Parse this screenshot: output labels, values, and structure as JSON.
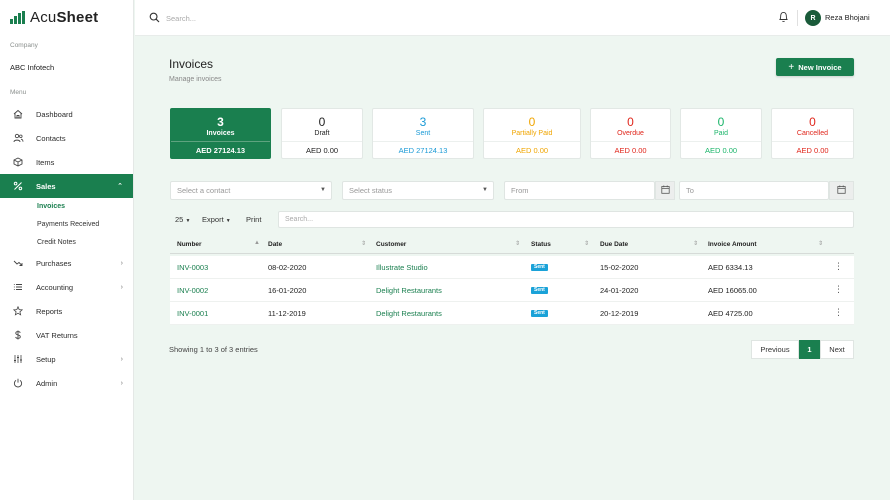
{
  "app": {
    "logo_text_light": "Acu",
    "logo_text_bold": "Sheet"
  },
  "sidebar": {
    "company_label": "Company",
    "company_name": "ABC Infotech",
    "menu_label": "Menu",
    "items": [
      {
        "label": "Dashboard",
        "icon": "home-icon"
      },
      {
        "label": "Contacts",
        "icon": "users-icon"
      },
      {
        "label": "Items",
        "icon": "box-icon"
      },
      {
        "label": "Sales",
        "icon": "percent-icon",
        "active": true
      },
      {
        "label": "Purchases",
        "icon": "trend-down-icon"
      },
      {
        "label": "Accounting",
        "icon": "list-icon"
      },
      {
        "label": "Reports",
        "icon": "star-icon"
      },
      {
        "label": "VAT Returns",
        "icon": "dollar-icon"
      },
      {
        "label": "Setup",
        "icon": "sliders-icon"
      },
      {
        "label": "Admin",
        "icon": "power-icon"
      }
    ],
    "sales_sub": [
      "Invoices",
      "Payments Received",
      "Credit Notes"
    ]
  },
  "topbar": {
    "search_placeholder": "Search...",
    "user_initial": "R",
    "user_name": "Reza Bhojani"
  },
  "page": {
    "title": "Invoices",
    "subtitle": "Manage invoices",
    "new_button": "New Invoice"
  },
  "status_cards": [
    {
      "count": "3",
      "label": "Invoices",
      "amount": "AED 27124.13",
      "color": "#ffffff"
    },
    {
      "count": "0",
      "label": "Draft",
      "amount": "AED 0.00",
      "color": "#222222"
    },
    {
      "count": "3",
      "label": "Sent",
      "amount": "AED 27124.13",
      "color": "#1a9ad6"
    },
    {
      "count": "0",
      "label": "Partially Paid",
      "amount": "AED 0.00",
      "color": "#f0a500"
    },
    {
      "count": "0",
      "label": "Overdue",
      "amount": "AED 0.00",
      "color": "#e0261b"
    },
    {
      "count": "0",
      "label": "Paid",
      "amount": "AED 0.00",
      "color": "#1bb56a"
    },
    {
      "count": "0",
      "label": "Cancelled",
      "amount": "AED 0.00",
      "color": "#e0261b"
    }
  ],
  "filters": {
    "contact_placeholder": "Select a contact",
    "status_placeholder": "Select status",
    "from_placeholder": "From",
    "to_placeholder": "To"
  },
  "table_tools": {
    "page_size": "25",
    "export": "Export",
    "print": "Print",
    "search_placeholder": "Search..."
  },
  "table": {
    "headers": [
      "Number",
      "Date",
      "Customer",
      "Status",
      "Due Date",
      "Invoice Amount"
    ],
    "rows": [
      {
        "number": "INV-0003",
        "date": "08-02-2020",
        "customer": "Illustrate Studio",
        "status": "Sent",
        "due": "15-02-2020",
        "amount": "AED 6334.13"
      },
      {
        "number": "INV-0002",
        "date": "16-01-2020",
        "customer": "Delight Restaurants",
        "status": "Sent",
        "due": "24-01-2020",
        "amount": "AED 16065.00"
      },
      {
        "number": "INV-0001",
        "date": "11-12-2019",
        "customer": "Delight Restaurants",
        "status": "Sent",
        "due": "20-12-2019",
        "amount": "AED 4725.00"
      }
    ]
  },
  "footer": {
    "showing": "Showing 1 to 3 of 3 entries",
    "prev": "Previous",
    "page": "1",
    "next": "Next"
  }
}
